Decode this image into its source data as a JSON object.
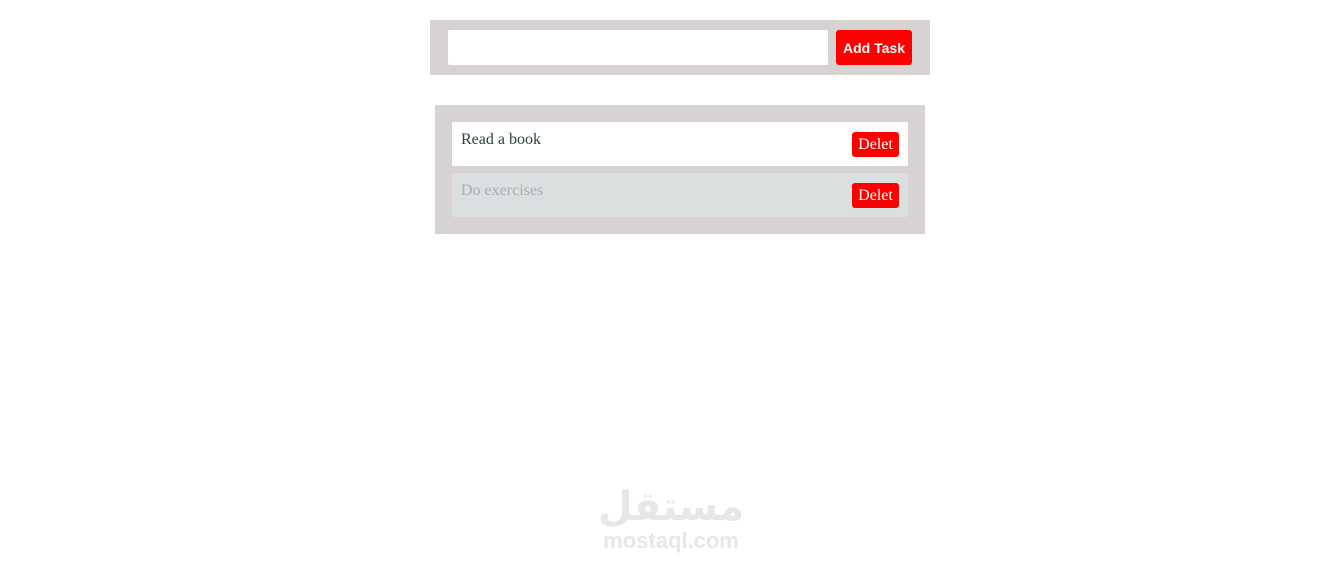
{
  "form": {
    "input_value": "",
    "input_placeholder": "",
    "add_label": "Add Task"
  },
  "tasks": [
    {
      "text": "Read a book",
      "completed": false,
      "delete_label": "Delet"
    },
    {
      "text": "Do exercises",
      "completed": true,
      "delete_label": "Delet"
    }
  ],
  "watermark": {
    "arabic": "مستقل",
    "latin": "mostaql.com"
  },
  "colors": {
    "accent": "#ff0000",
    "panel": "#d6d3d2",
    "completed_row": "#dcdfe0"
  }
}
